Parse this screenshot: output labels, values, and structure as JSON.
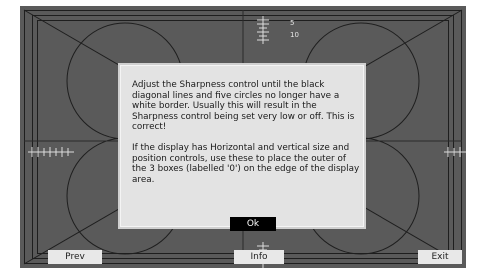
{
  "pattern": {
    "tick_labels": [
      "5",
      "10"
    ]
  },
  "dialog": {
    "paragraph_1": "Adjust the Sharpness control until the black diagonal lines and five circles no longer have a white border. Usually this will result in the Sharpness control being set very low or off. This is correct!",
    "paragraph_2": "If the display has Horizontal and vertical size and position controls, use these to place the outer of the 3 boxes (labelled '0') on the edge of the display area.",
    "ok_label": "Ok"
  },
  "nav": {
    "prev_label": "Prev",
    "info_label": "Info",
    "exit_label": "Exit"
  },
  "colors": {
    "screen_background": "#5a5a5a",
    "pattern_lines": "#1e1e1e",
    "dialog_background": "#e3e3e3",
    "ok_button": "#000000"
  }
}
